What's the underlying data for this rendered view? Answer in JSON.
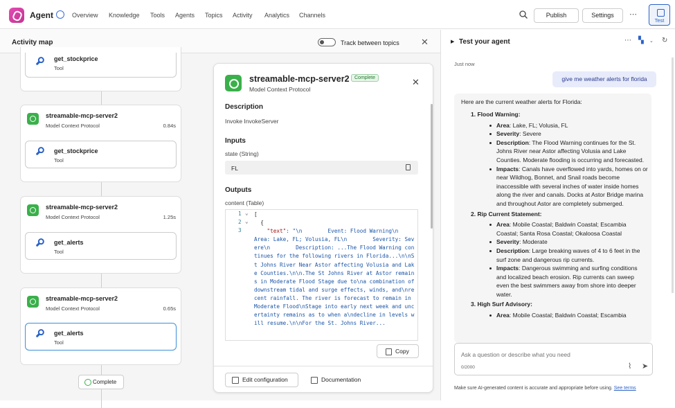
{
  "app": {
    "name": "Agent"
  },
  "nav": [
    "Overview",
    "Knowledge",
    "Tools",
    "Agents",
    "Topics",
    "Activity",
    "Analytics",
    "Channels"
  ],
  "top_buttons": {
    "publish": "Publish",
    "settings": "Settings",
    "more": "⋯",
    "test": "Test"
  },
  "activity": {
    "title": "Activity map",
    "toggle_label": "Track between topics",
    "close": "✕",
    "groups": [
      {
        "name": "streamable-mcp-server2",
        "sub": "Model Context Protocol",
        "time": "0.84s",
        "tool": "get_stockprice",
        "tool_sub": "Tool"
      },
      {
        "name": "streamable-mcp-server2",
        "sub": "Model Context Protocol",
        "time": "1.25s",
        "tool": "get_alerts",
        "tool_sub": "Tool"
      },
      {
        "name": "streamable-mcp-server2",
        "sub": "Model Context Protocol",
        "time": "0.65s",
        "tool": "get_alerts",
        "tool_sub": "Tool"
      }
    ],
    "top_tool": {
      "name": "get_stockprice",
      "sub": "Tool"
    },
    "complete": "Complete"
  },
  "detail": {
    "name": "streamable-mcp-server2",
    "badge": "Complete",
    "sub": "Model Context Protocol",
    "close": "✕",
    "description_h": "Description",
    "description": "Invoke InvokeServer",
    "inputs_h": "Inputs",
    "input_label": "state (String)",
    "input_value": "FL",
    "outputs_h": "Outputs",
    "output_label": "content (Table)",
    "code_line1": "[",
    "code_line2": "  {",
    "code_key": "\"text\"",
    "code_text": ": \"\\n        Event: Flood Warning\\n        Area: Lake, FL; Volusia, FL\\n        Severity: Severe\\n        Description: ...The Flood Warning continues for the following rivers in Florida...\\n\\nSt Johns River Near Astor affecting Volusia and Lake Counties.\\n\\n.The St Johns River at Astor remains in Moderate Flood Stage due to\\na combination of downstream tidal and surge effects, winds, and\\nrecent rainfall. The river is forecast to remain in Moderate Flood\\nStage into early next week and uncertainty remains as to when a\\ndecline in levels will resume.\\n\\nFor the St. Johns River...",
    "copy": "Copy",
    "edit": "Edit configuration",
    "docs": "Documentation"
  },
  "test": {
    "title": "Test your agent",
    "just_now": "Just now",
    "user_msg": "give me weather alerts for florida",
    "intro": "Here are the current weather alerts for Florida:",
    "alerts": [
      {
        "heading": "1. Flood Warning:",
        "items": [
          {
            "label": "Area",
            "text": ": Lake, FL; Volusia, FL"
          },
          {
            "label": "Severity",
            "text": ": Severe"
          },
          {
            "label": "Description",
            "text": ": The Flood Warning continues for the St. Johns River near Astor affecting Volusia and Lake Counties. Moderate flooding is occurring and forecasted."
          },
          {
            "label": "Impacts",
            "text": ": Canals have overflowed into yards, homes on or near Wildhog, Bonnet, and Snail roads become inaccessible with several inches of water inside homes along the river and canals. Docks at Astor Bridge marina and throughout Astor are completely submerged."
          }
        ]
      },
      {
        "heading": "2. Rip Current Statement:",
        "items": [
          {
            "label": "Area",
            "text": ": Mobile Coastal; Baldwin Coastal; Escambia Coastal; Santa Rosa Coastal; Okaloosa Coastal"
          },
          {
            "label": "Severity",
            "text": ": Moderate"
          },
          {
            "label": "Description",
            "text": ": Large breaking waves of 4 to 6 feet in the surf zone and dangerous rip currents."
          },
          {
            "label": "Impacts",
            "text": ": Dangerous swimming and surfing conditions and localized beach erosion. Rip currents can sweep even the best swimmers away from shore into deeper water."
          }
        ]
      },
      {
        "heading": "3. High Surf Advisory:",
        "items": [
          {
            "label": "Area",
            "text": ": Mobile Coastal; Baldwin Coastal; Escambia"
          }
        ]
      }
    ],
    "placeholder": "Ask a question or describe what you need",
    "count": "0/2000",
    "disclaimer": "Make sure AI-generated content is accurate and appropriate before using.",
    "see_terms": "See terms"
  }
}
